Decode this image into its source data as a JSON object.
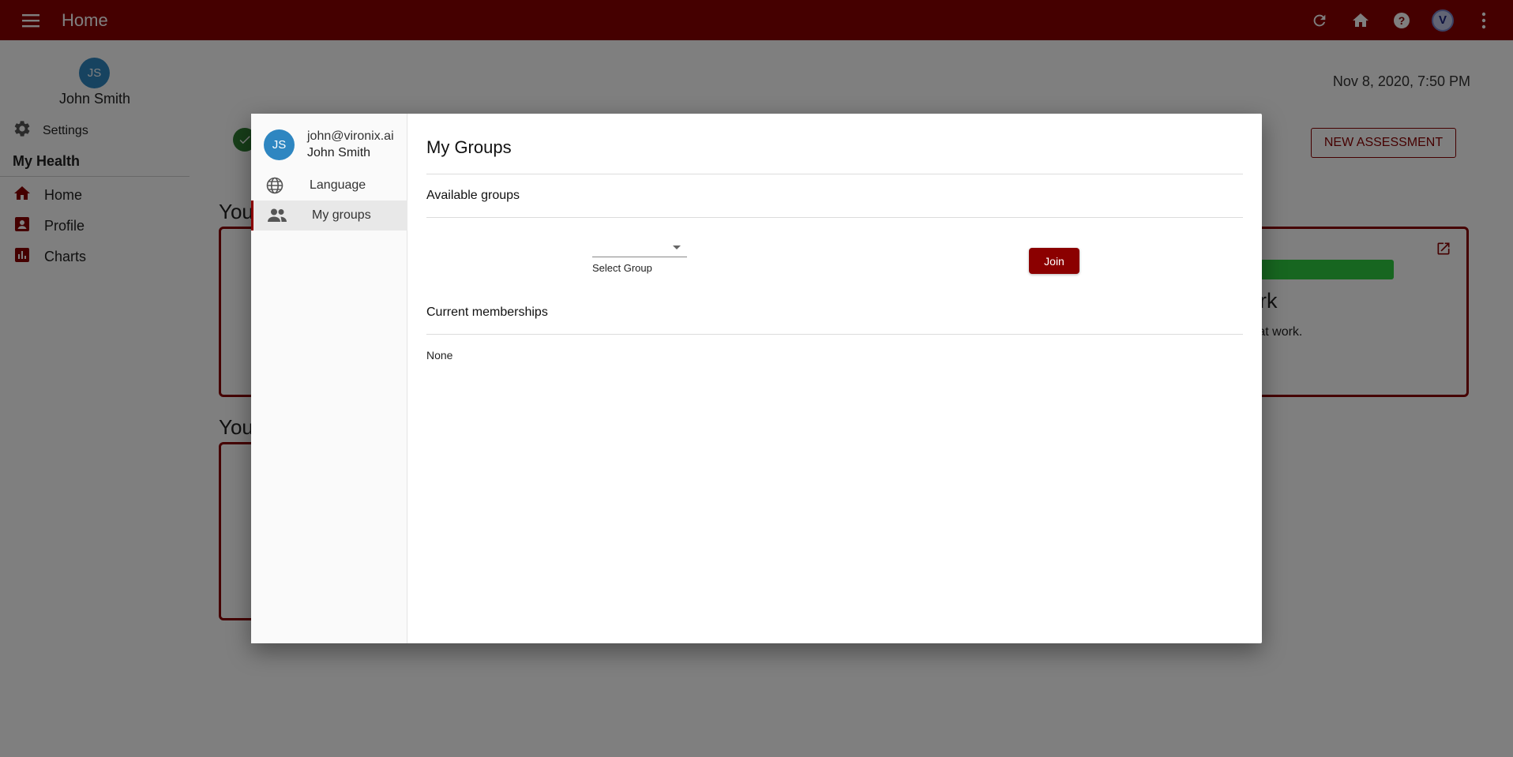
{
  "appbar": {
    "title": "Home",
    "bg_color": "#8b0000",
    "avatar_letter": "V"
  },
  "sidebar": {
    "avatar_initials": "JS",
    "user_name": "John Smith",
    "settings_label": "Settings",
    "section_title": "My Health",
    "items": [
      {
        "label": "Home",
        "icon": "home-icon"
      },
      {
        "label": "Profile",
        "icon": "profile-icon"
      },
      {
        "label": "Charts",
        "icon": "chart-icon"
      }
    ]
  },
  "main": {
    "datetime": "Nov 8, 2020, 7:50 PM",
    "new_assessment_label": "NEW ASSESSMENT",
    "section1_title_partial": "You",
    "section2_title_partial": "You",
    "card_heading_partial": "ork",
    "card_text_partial": "e at work."
  },
  "dialog": {
    "user_initials": "JS",
    "user_email": "john@vironix.ai",
    "user_name": "John Smith",
    "nav": [
      {
        "label": "Language",
        "icon": "globe-icon",
        "active": false
      },
      {
        "label": "My groups",
        "icon": "group-icon",
        "active": true
      }
    ],
    "title": "My Groups",
    "available_groups_label": "Available groups",
    "select_label": "Select Group",
    "select_value": "",
    "join_label": "Join",
    "current_memberships_label": "Current memberships",
    "memberships_empty": "None"
  }
}
